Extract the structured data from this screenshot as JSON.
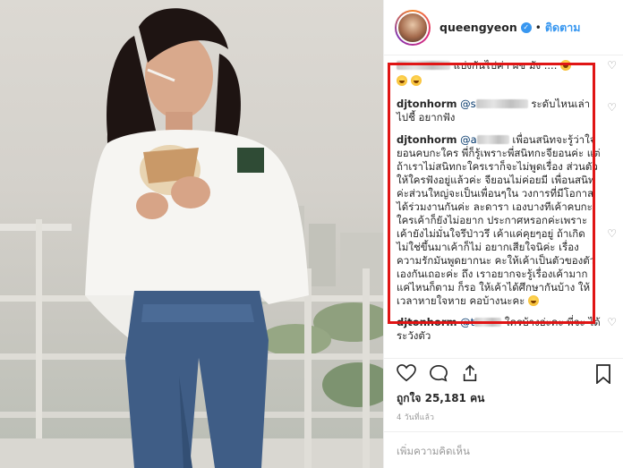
{
  "post": {
    "username": "queengyeon",
    "follow_label": "ติดตาม",
    "separator": "•"
  },
  "comments": [
    {
      "user": "",
      "text": "แบ่งกันไปค่า ผช มัง ....",
      "emoji": true
    },
    {
      "user": "",
      "text": "",
      "emoji": true
    },
    {
      "user": "djtonhorm",
      "mention": "@s",
      "text": "ระดับไหนเล่า ไปชี้ อยากฟัง"
    },
    {
      "user": "djtonhorm",
      "mention": "@a",
      "text": "เพื่อนสนิทจะรู้ว่าใจ ยอนคบกะใคร พี่ก็รู้เพราะพี่สนิทกะจียอนค่ะ แต่ถ้าเราไม่สนิทกะใครเราก็จะไม่พูดเรื่อง ส่วนตัวให้ใครฟังอยู่แล้วค่ะ จียอนไม่ค่อยมี เพื่อนสนิทค่ะส่วนใหญ่จะเป็นเพื่อนๆใน วงการที่มีโอกาสได้ร่วมงานกันค่ะ ละดารา เองบางทีเค้าคบกะใครเค้าก็ยังไม่อยาก ประกาศหรอกค่ะเพราะเค้ายังไม่มั่นใจรึป่าวรึ เค้าแค่คุยๆอยู่ ถ้าเกิดไม่ใช่ขึ้นมาเค้าก็ไม่ อยากเสียใจนิค่ะ เรื่องความรักมันพูดยากนะ คะให้เค้าเป็นตัวของตัวเองกันเถอะค่ะ ถึง เราอยากจะรู้เรื่องเค้ามากแค่ไหนก็ตาม ก็รอ ให้เค้าได้ศึกษากันบ้าง ให้เวลาหายใจหาย คอบ้างนะคะ",
      "emoji": true
    },
    {
      "user": "djtonhorm",
      "mention": "@t",
      "text": "ใครบ้างอ่ะคะ พี่จะ ได้ระวังตัว"
    }
  ],
  "likes_label": "ถูกใจ 25,181 คน",
  "time_label": "4 วันที่แล้ว",
  "add_comment_placeholder": "เพิ่มความคิดเห็น",
  "icons": [
    "heart-icon",
    "comment-icon",
    "share-icon",
    "bookmark-icon",
    "verified-badge-icon"
  ],
  "colors": {
    "accent": "#3897f0",
    "highlight": "#e01515",
    "muted": "#999999"
  }
}
